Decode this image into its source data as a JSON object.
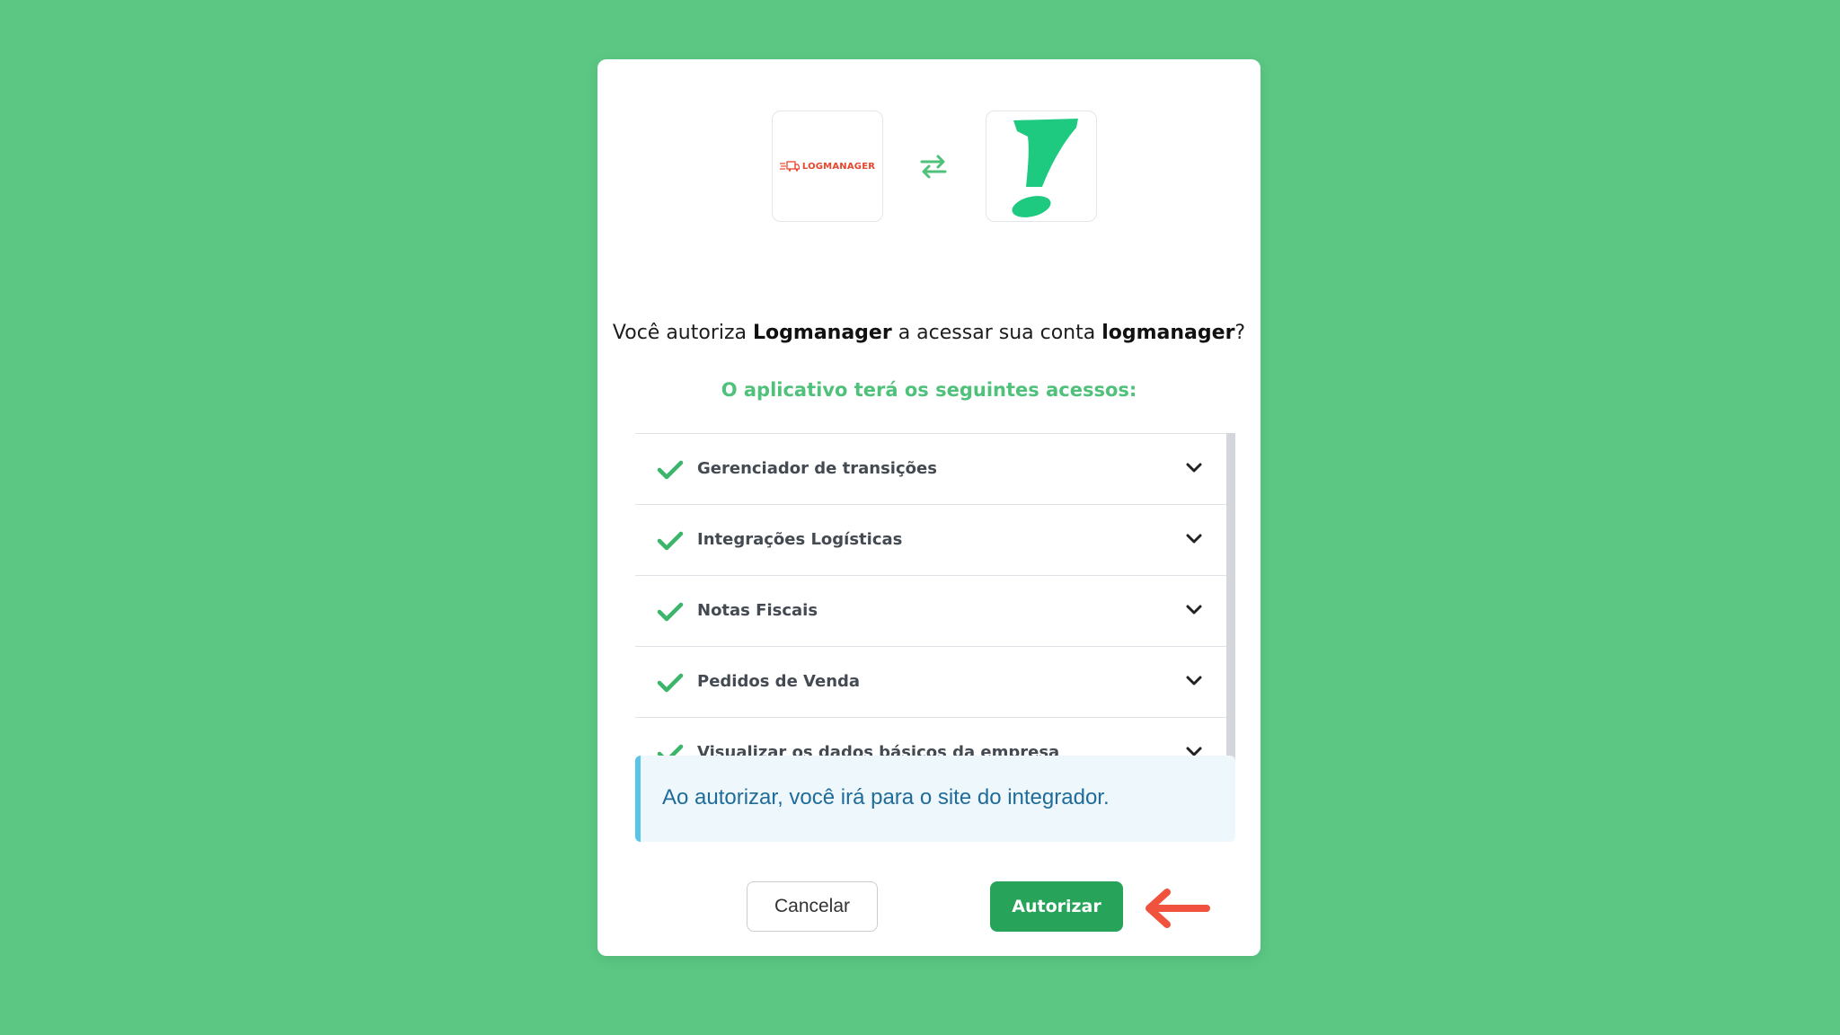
{
  "brand": {
    "left_logo_text": "LOGMANAGER",
    "accent_color": "#4fc17a",
    "button_color": "#27a35a",
    "arrow_color": "#f0523e"
  },
  "prompt": {
    "part1": "Você autoriza ",
    "app_name": "Logmanager",
    "part2": " a acessar sua conta ",
    "account_name": "logmanager",
    "part3": "?"
  },
  "access_title": "O aplicativo terá os seguintes acessos:",
  "permissions": [
    {
      "label": "Gerenciador de transições"
    },
    {
      "label": "Integrações Logísticas"
    },
    {
      "label": "Notas Fiscais"
    },
    {
      "label": "Pedidos de Venda"
    },
    {
      "label": "Visualizar os dados básicos da empresa"
    }
  ],
  "info": {
    "text": "Ao autorizar, você irá para o site do integrador."
  },
  "buttons": {
    "cancel_label": "Cancelar",
    "authorize_label": "Autorizar"
  },
  "icons": {
    "swap": "swap-arrows-icon",
    "check": "check-icon",
    "chevron": "chevron-down-icon",
    "pointer": "arrow-left-icon"
  }
}
